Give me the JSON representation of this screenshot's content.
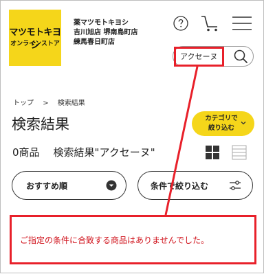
{
  "header": {
    "logo_main": "マツモトキヨシ",
    "logo_sub": "オンラインストア",
    "store_lines": [
      "薬マツモトキヨシ",
      "吉川旭店 堺南島町店",
      "練馬春日町店"
    ],
    "icons": [
      "help-icon",
      "cart-icon",
      "menu-icon"
    ]
  },
  "search": {
    "value": "アクセーヌ",
    "icon": "search-icon"
  },
  "breadcrumb": [
    "トップ",
    ">",
    "検索結果"
  ],
  "page_title": "検索結果",
  "category_button": [
    "カテゴリで",
    "絞り込む"
  ],
  "results": {
    "count": "0商品",
    "query_label": "検索結果\"アクセーヌ\""
  },
  "sort_button": "おすすめ順",
  "filter_button": "条件で絞り込む",
  "no_result_message": "ご指定の条件に合致する商品はありませんでした。",
  "colors": {
    "brand_yellow": "#f5d61a",
    "highlight_red": "#e8202a",
    "message_red": "#d0121b"
  }
}
